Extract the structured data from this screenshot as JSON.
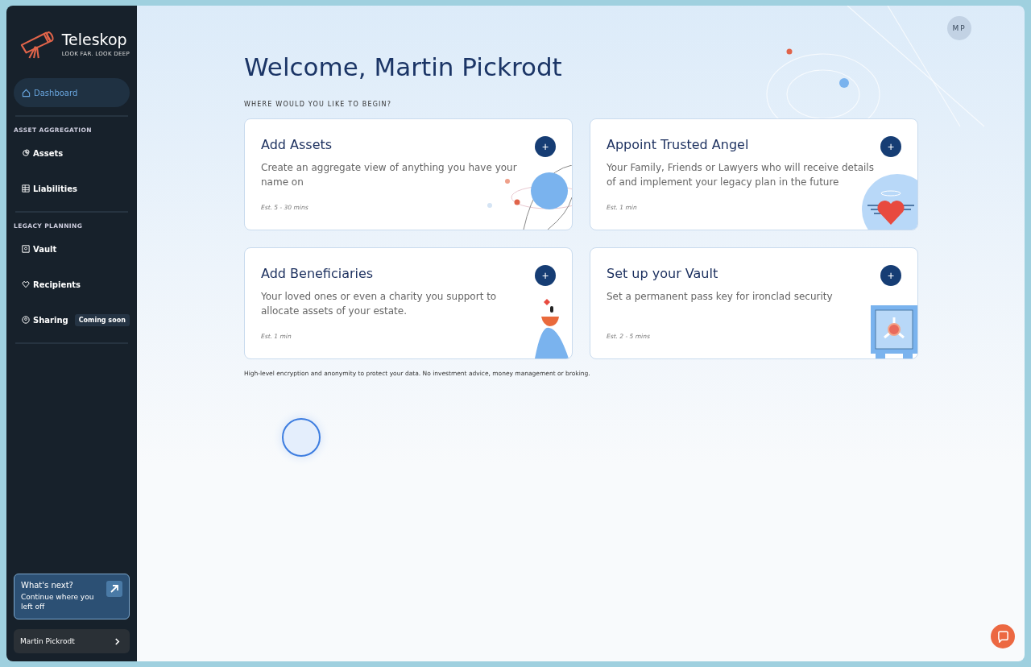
{
  "brand": {
    "name": "Teleskop",
    "tagline": "LOOK FAR. LOOK DEEP"
  },
  "sidebar": {
    "items": [
      {
        "label": "Dashboard",
        "selected": true
      }
    ],
    "sections": [
      {
        "title": "ASSET AGGREGATION",
        "items": [
          {
            "label": "Assets",
            "selected": false
          },
          {
            "label": "Liabilities",
            "selected": false
          }
        ]
      },
      {
        "title": "LEGACY PLANNING",
        "items": [
          {
            "label": "Vault",
            "selected": false
          },
          {
            "label": "Recipients",
            "selected": false
          },
          {
            "label": "Sharing",
            "selected": false,
            "badge": "Coming soon"
          }
        ]
      }
    ],
    "next_card": {
      "title": "What's next?",
      "text": "Continue where you left off"
    },
    "user": {
      "name": "Martin Pickrodt"
    }
  },
  "avatar": "MP",
  "heading": "Welcome, Martin Pickrodt",
  "subheading": "WHERE WOULD YOU LIKE TO BEGIN?",
  "cards": [
    {
      "title": "Add Assets",
      "text": "Create an aggregate view of anything you have your name on",
      "estimate": "Est. 5 - 30 mins",
      "kind": "planet",
      "button": "+"
    },
    {
      "title": "Appoint Trusted Angel",
      "text": "Your Family, Friends or Lawyers who will receive details of and implement your legacy plan in the future",
      "estimate": "Est. 1 min",
      "kind": "angel",
      "button": "+"
    },
    {
      "title": "Add Beneficiaries",
      "text": "Your loved ones or even a charity you support to allocate assets of your estate.",
      "estimate": "Est. 1 min",
      "kind": "person",
      "button": "+"
    },
    {
      "title": "Set up your Vault",
      "text": "Set a permanent pass key for ironclad security",
      "estimate": "Est. 2 - 5 mins",
      "kind": "safe",
      "button": "+"
    }
  ],
  "footnote": "High-level encryption and anonymity to protect your data. No investment advice, money management or broking."
}
